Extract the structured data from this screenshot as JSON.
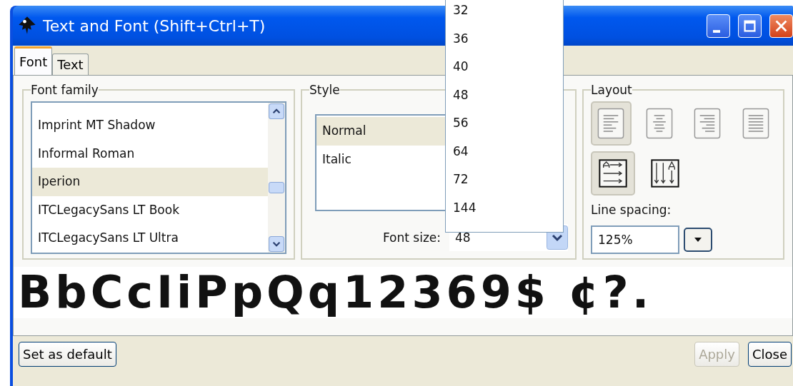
{
  "window": {
    "title": "Text and Font (Shift+Ctrl+T)"
  },
  "tabs": [
    {
      "label": "Font",
      "selected": true
    },
    {
      "label": "Text",
      "selected": false
    }
  ],
  "font_family": {
    "title": "Font family",
    "items": [
      {
        "label": "Imprint MT Shadow",
        "selected": false
      },
      {
        "label": "Informal Roman",
        "selected": false
      },
      {
        "label": "Iperion",
        "selected": true
      },
      {
        "label": "ITCLegacySans LT Book",
        "selected": false
      },
      {
        "label": "ITCLegacySans LT Ultra",
        "selected": false
      }
    ]
  },
  "style": {
    "title": "Style",
    "items": [
      {
        "label": "Normal",
        "selected": true
      },
      {
        "label": "Italic",
        "selected": false
      }
    ],
    "font_size": {
      "label": "Font size:",
      "value": "48",
      "options": [
        "32",
        "36",
        "40",
        "48",
        "56",
        "64",
        "72",
        "144"
      ]
    }
  },
  "layout": {
    "title": "Layout",
    "alignments": [
      {
        "kind": "left",
        "selected": true
      },
      {
        "kind": "center",
        "selected": false
      },
      {
        "kind": "right",
        "selected": false
      },
      {
        "kind": "justify",
        "selected": false
      }
    ],
    "orientations": [
      {
        "kind": "horizontal",
        "selected": true
      },
      {
        "kind": "vertical",
        "selected": false
      }
    ],
    "line_spacing": {
      "label": "Line spacing:",
      "value": "125%"
    }
  },
  "preview": {
    "text": "BbCcIiPpQq12369$ ¢?."
  },
  "buttons": [
    {
      "label": "Set as default",
      "disabled": false
    },
    {
      "label": "Apply",
      "disabled": true
    },
    {
      "label": "Close",
      "disabled": false
    }
  ]
}
